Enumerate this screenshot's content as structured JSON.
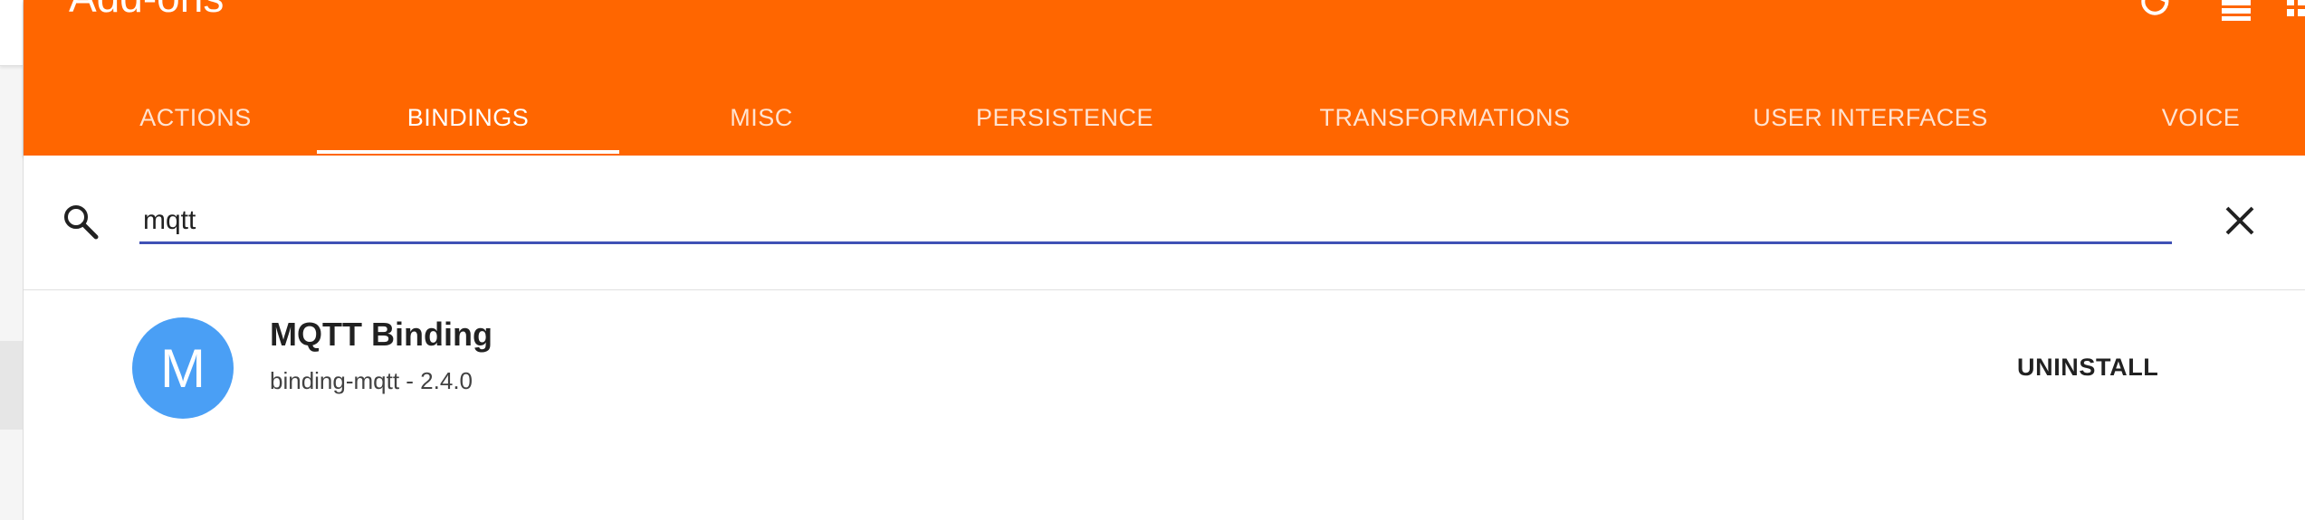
{
  "app": {
    "title": "Add-ons",
    "accent": "#ff6600",
    "underline_color": "#3f51b5"
  },
  "toolbar": {
    "buttons": [
      {
        "name": "refresh-icon"
      },
      {
        "name": "list-view-icon"
      },
      {
        "name": "grid-view-icon"
      }
    ]
  },
  "tabs": {
    "items": [
      {
        "label": "ACTIONS"
      },
      {
        "label": "BINDINGS"
      },
      {
        "label": "MISC"
      },
      {
        "label": "PERSISTENCE"
      },
      {
        "label": "TRANSFORMATIONS"
      },
      {
        "label": "USER INTERFACES"
      },
      {
        "label": "VOICE"
      }
    ],
    "active": "BINDINGS"
  },
  "search": {
    "value": "mqtt",
    "icon": "search-icon",
    "clear_icon": "close-icon"
  },
  "results": [
    {
      "avatar_letter": "M",
      "avatar_color": "#4a9ff5",
      "title": "MQTT Binding",
      "subtitle": "binding-mqtt - 2.4.0",
      "action_label": "UNINSTALL"
    }
  ]
}
